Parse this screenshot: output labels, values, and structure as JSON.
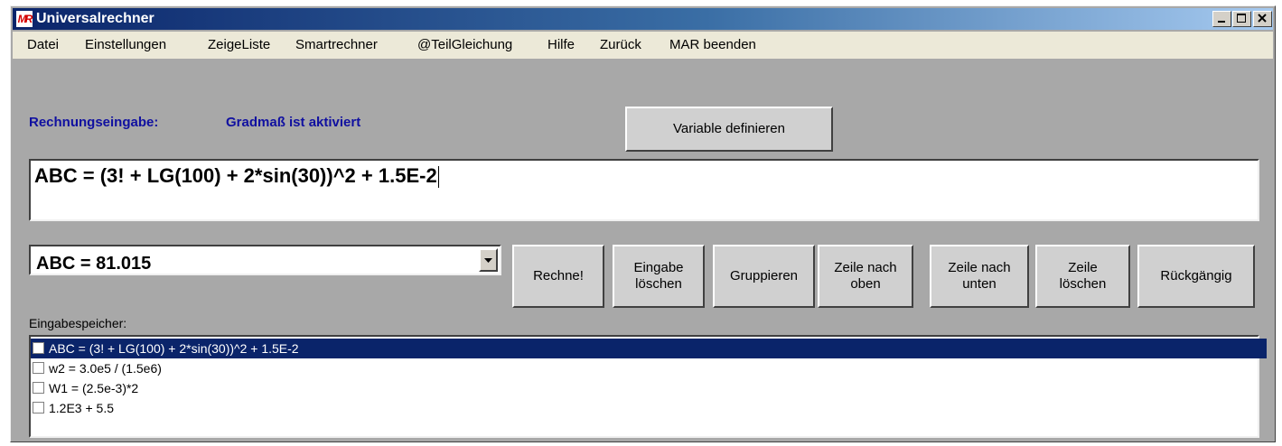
{
  "window": {
    "title": "Universalrechner",
    "icon": "app-logo-icon",
    "icon_text": "MR"
  },
  "menu": [
    {
      "label": "Datei"
    },
    {
      "label": "Einstellungen"
    },
    {
      "label": "ZeigeListe"
    },
    {
      "label": "Smartrechner"
    },
    {
      "label": "@TeilGleichung"
    },
    {
      "label": "Hilfe"
    },
    {
      "label": "Zurück"
    },
    {
      "label": "MAR beenden"
    }
  ],
  "labels": {
    "input_label": "Rechnungseingabe:",
    "mode_status": "Gradmaß ist aktiviert",
    "memory_label": "Eingabespeicher:"
  },
  "buttons": {
    "define_variable": "Variable definieren",
    "calculate": "Rechne!",
    "clear_input": "Eingabe\nlöschen",
    "group": "Gruppieren",
    "row_up": "Zeile nach\noben",
    "row_down": "Zeile nach\nunten",
    "delete_row": "Zeile\nlöschen",
    "undo": "Rückgängig"
  },
  "formula_input": {
    "value": "ABC = (3! + LG(100) + 2*sin(30))^2 + 1.5E-2"
  },
  "result_combo": {
    "value": "ABC = 81.015"
  },
  "memory_list": [
    {
      "text": "ABC = (3! + LG(100) + 2*sin(30))^2 + 1.5E-2",
      "selected": true,
      "checked": false
    },
    {
      "text": "w2 = 3.0e5 / (1.5e6)",
      "selected": false,
      "checked": false
    },
    {
      "text": "W1 = (2.5e-3)*2",
      "selected": false,
      "checked": false
    },
    {
      "text": "1.2E3 + 5.5",
      "selected": false,
      "checked": false
    }
  ],
  "colors": {
    "titlebar_start": "#0a246a",
    "titlebar_end": "#a6caf0",
    "label_blue": "#1010a0",
    "selection": "#0a246a",
    "client_bg": "#a8a8a8"
  }
}
